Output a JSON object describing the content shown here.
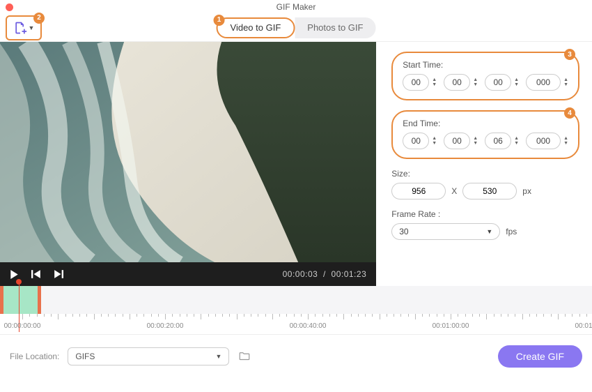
{
  "title": "GIF Maker",
  "badges": {
    "add": "2",
    "tab": "1",
    "start": "3",
    "end": "4"
  },
  "tabs": {
    "video": "Video to GIF",
    "photos": "Photos to GIF"
  },
  "start": {
    "label": "Start Time:",
    "h": "00",
    "m": "00",
    "s": "00",
    "ms": "000"
  },
  "end": {
    "label": "End Time:",
    "h": "00",
    "m": "00",
    "s": "06",
    "ms": "000"
  },
  "size": {
    "label": "Size:",
    "w": "956",
    "h": "530",
    "sep": "X",
    "unit": "px"
  },
  "frameRate": {
    "label": "Frame Rate :",
    "value": "30",
    "unit": "fps"
  },
  "player": {
    "current": "00:00:03",
    "sep": "/",
    "total": "00:01:23"
  },
  "ruler": [
    "00:00:00:00",
    "00:00:20:00",
    "00:00:40:00",
    "00:01:00:00",
    "00:01"
  ],
  "footer": {
    "label": "File Location:",
    "value": "GIFS",
    "create": "Create GIF"
  }
}
